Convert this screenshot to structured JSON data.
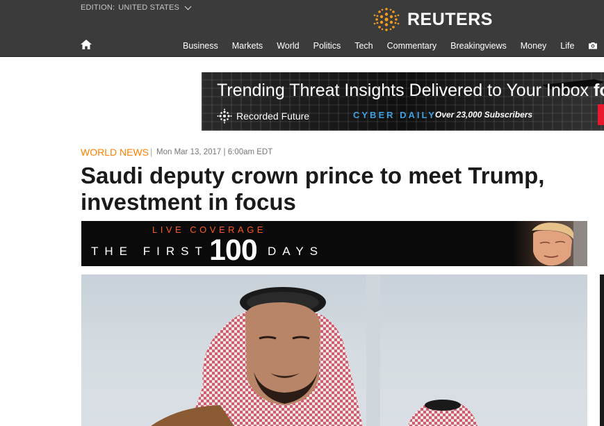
{
  "header": {
    "edition_label": "EDITION:",
    "edition_value": "UNITED STATES",
    "logo_text": "REUTERS",
    "nav": [
      "Business",
      "Markets",
      "World",
      "Politics",
      "Tech",
      "Commentary",
      "Breakingviews",
      "Money",
      "Life"
    ]
  },
  "ad": {
    "headline": "Trending Threat Insights Delivered to Your Inbox",
    "headline_cut": "fo",
    "brand": "Recorded Future",
    "cyber": "CYBER DAILY",
    "subscribers": "Over 23,000 Subscribers"
  },
  "article": {
    "section": "WORLD NEWS",
    "separator": "|",
    "dateline": "Mon Mar 13, 2017 | 6:00am EDT",
    "title": "Saudi deputy crown prince to meet Trump, investment in focus"
  },
  "banner": {
    "live": "LIVE COVERAGE",
    "first": "THE FIRST",
    "number": "100",
    "days": "DAYS"
  },
  "colors": {
    "header_bg": "#3b3b3b",
    "accent_orange": "#ff8000",
    "live_orange": "#ff5a1f",
    "logo_orange": "#f39a1f"
  }
}
